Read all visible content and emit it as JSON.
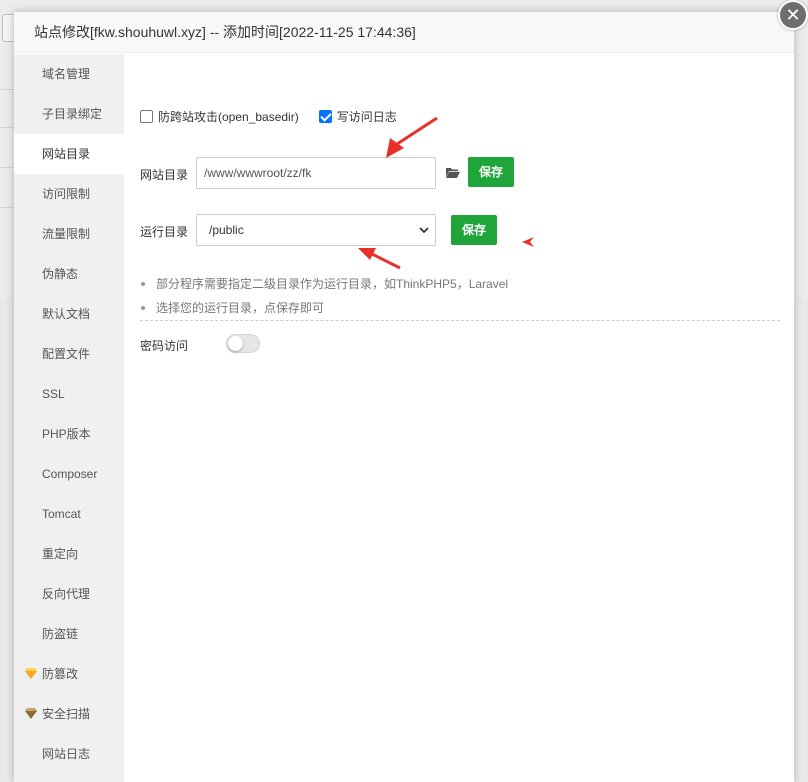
{
  "dialog": {
    "title": "站点修改[fkw.shouhuwl.xyz] -- 添加时间[2022-11-25 17:44:36]",
    "close_icon": "close-icon"
  },
  "sidebar": {
    "items": [
      {
        "label": "域名管理"
      },
      {
        "label": "子目录绑定"
      },
      {
        "label": "网站目录",
        "active": true
      },
      {
        "label": "访问限制"
      },
      {
        "label": "流量限制"
      },
      {
        "label": "伪静态"
      },
      {
        "label": "默认文档"
      },
      {
        "label": "配置文件"
      },
      {
        "label": "SSL"
      },
      {
        "label": "PHP版本"
      },
      {
        "label": "Composer"
      },
      {
        "label": "Tomcat"
      },
      {
        "label": "重定向"
      },
      {
        "label": "反向代理"
      },
      {
        "label": "防盗链"
      },
      {
        "label": "防篡改",
        "icon": "diamond-icon"
      },
      {
        "label": "安全扫描",
        "icon": "diamond-icon"
      },
      {
        "label": "网站日志"
      }
    ]
  },
  "options": {
    "open_basedir": {
      "label": "防跨站攻击(open_basedir)",
      "checked": false
    },
    "access_log": {
      "label": "写访问日志",
      "checked": true
    }
  },
  "site_dir": {
    "label": "网站目录",
    "value": "/www/wwwroot/zz/fk",
    "save_label": "保存"
  },
  "run_dir": {
    "label": "运行目录",
    "value": "/public",
    "save_label": "保存"
  },
  "tips": [
    "部分程序需要指定二级目录作为运行目录，如ThinkPHP5，Laravel",
    "选择您的运行目录，点保存即可"
  ],
  "password_access": {
    "label": "密码访问",
    "enabled": false
  },
  "colors": {
    "accent_green": "#20a53a",
    "annotation_red": "#e8302b",
    "checkbox_blue": "#0075ff"
  }
}
